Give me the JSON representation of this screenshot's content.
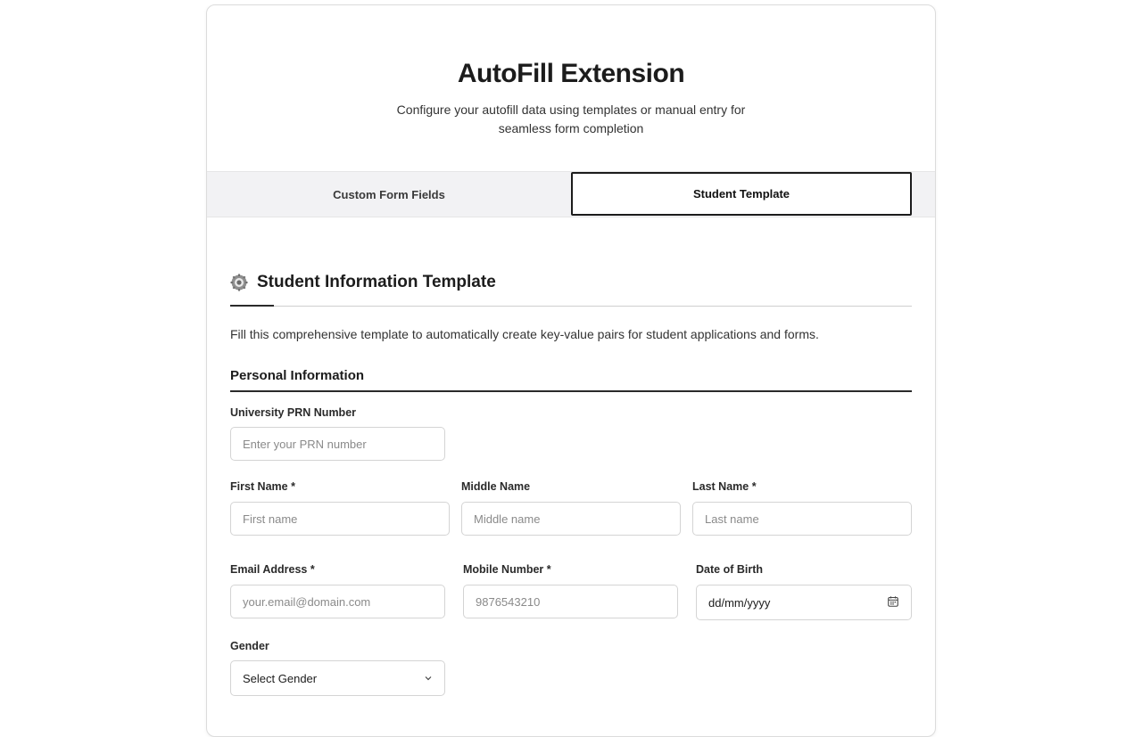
{
  "header": {
    "title": "AutoFill Extension",
    "subtitle": "Configure your autofill data using templates or manual entry for seamless form completion"
  },
  "tabs": [
    {
      "label": "Custom Form Fields",
      "active": false
    },
    {
      "label": "Student Template",
      "active": true
    }
  ],
  "section": {
    "icon": "gear-icon",
    "title": "Student Information Template",
    "description": "Fill this comprehensive template to automatically create key-value pairs for student applications and forms."
  },
  "personal": {
    "title": "Personal Information",
    "prn": {
      "label": "University PRN Number",
      "placeholder": "Enter your PRN number"
    },
    "first_name": {
      "label": "First Name *",
      "placeholder": "First name"
    },
    "middle_name": {
      "label": "Middle Name",
      "placeholder": "Middle name"
    },
    "last_name": {
      "label": "Last Name *",
      "placeholder": "Last name"
    },
    "email": {
      "label": "Email Address *",
      "placeholder": "your.email@domain.com"
    },
    "mobile": {
      "label": "Mobile Number *",
      "placeholder": "9876543210"
    },
    "dob": {
      "label": "Date of Birth",
      "value": "dd/mm/yyyy",
      "icon": "calendar-icon"
    },
    "gender": {
      "label": "Gender",
      "value": "Select Gender",
      "icon": "chevron-down-icon"
    }
  }
}
